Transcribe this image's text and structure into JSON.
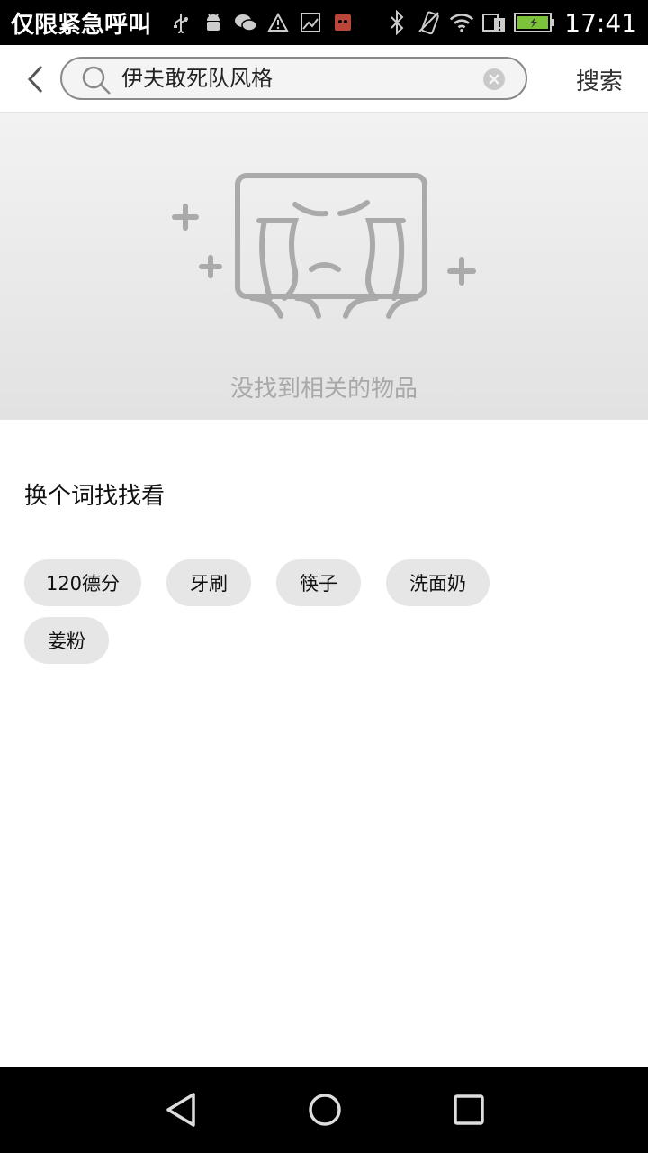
{
  "status_bar": {
    "carrier": "仅限紧急呼叫",
    "time": "17:41",
    "left_icons": [
      "usb-icon",
      "android-icon",
      "wechat-icon",
      "warning-icon",
      "image-icon",
      "app-icon"
    ],
    "right_icons": [
      "bluetooth-icon",
      "vibrate-icon",
      "wifi-icon",
      "sim-alert-icon",
      "battery-icon"
    ]
  },
  "header": {
    "query": "伊夫敢死队风格",
    "search_label": "搜索"
  },
  "empty_state": {
    "message": "没找到相关的物品"
  },
  "suggestions": {
    "title": "换个词找找看",
    "tags": [
      "120德分",
      "牙刷",
      "筷子",
      "洗面奶",
      "姜粉"
    ]
  },
  "colors": {
    "accent_gray": "#a8a8a8",
    "tag_bg": "#e6e6e6"
  }
}
